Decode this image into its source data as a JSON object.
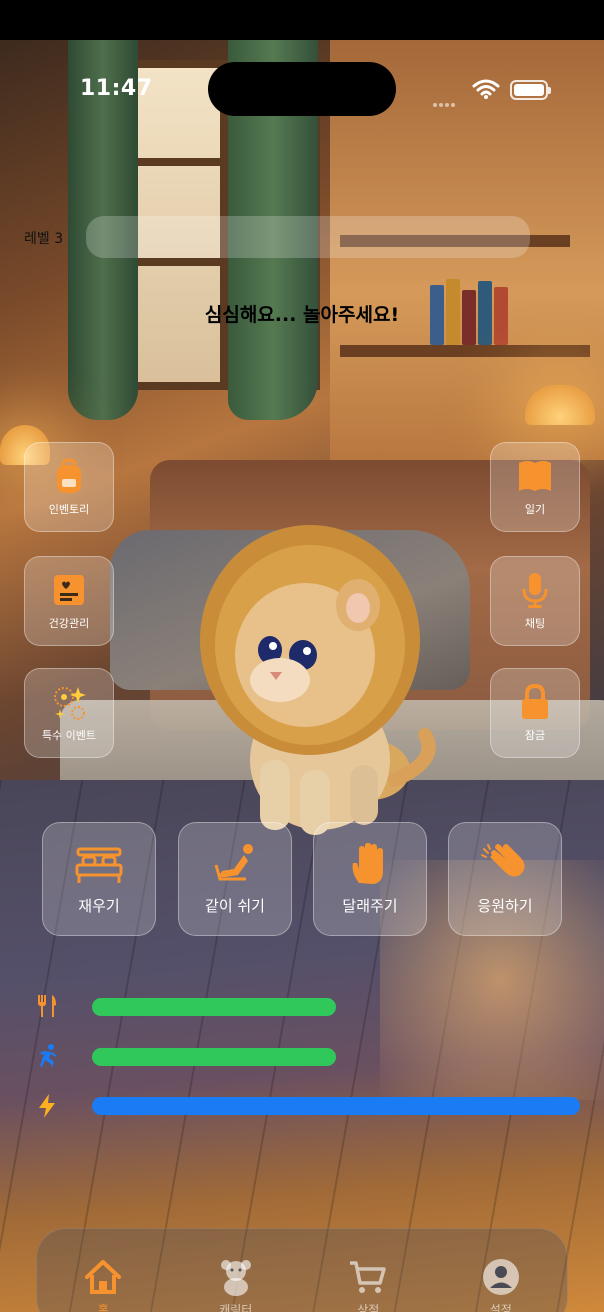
{
  "status_bar": {
    "time": "11:47"
  },
  "level": {
    "label": "레벨 3"
  },
  "mood": {
    "text": "심심해요... 놀아주세요!"
  },
  "side_left": [
    {
      "label": "인벤토리",
      "icon": "backpack-icon"
    },
    {
      "label": "건강관리",
      "icon": "health-card-icon"
    },
    {
      "label": "특수 이벤트",
      "icon": "sparkles-icon"
    }
  ],
  "side_right": [
    {
      "label": "일기",
      "icon": "book-icon"
    },
    {
      "label": "채팅",
      "icon": "microphone-icon"
    },
    {
      "label": "잠금",
      "icon": "lock-icon"
    }
  ],
  "actions": [
    {
      "label": "재우기",
      "icon": "bed-icon"
    },
    {
      "label": "같이 쉬기",
      "icon": "recline-icon"
    },
    {
      "label": "달래주기",
      "icon": "hand-icon"
    },
    {
      "label": "응원하기",
      "icon": "clapping-hands-icon"
    }
  ],
  "stats": [
    {
      "icon": "fork-knife-icon",
      "value": 0.5,
      "color": "#30c85a"
    },
    {
      "icon": "running-icon",
      "value": 0.5,
      "color": "#30c85a"
    },
    {
      "icon": "bolt-icon",
      "value": 1.0,
      "color": "#1a7cf5"
    }
  ],
  "tabs": [
    {
      "label": "홈",
      "icon": "home-icon",
      "active": true
    },
    {
      "label": "캐릭터",
      "icon": "teddy-bear-icon",
      "active": false
    },
    {
      "label": "상점",
      "icon": "cart-icon",
      "active": false
    },
    {
      "label": "설정",
      "icon": "profile-icon",
      "active": false
    }
  ],
  "colors": {
    "accent": "#f7932e"
  }
}
